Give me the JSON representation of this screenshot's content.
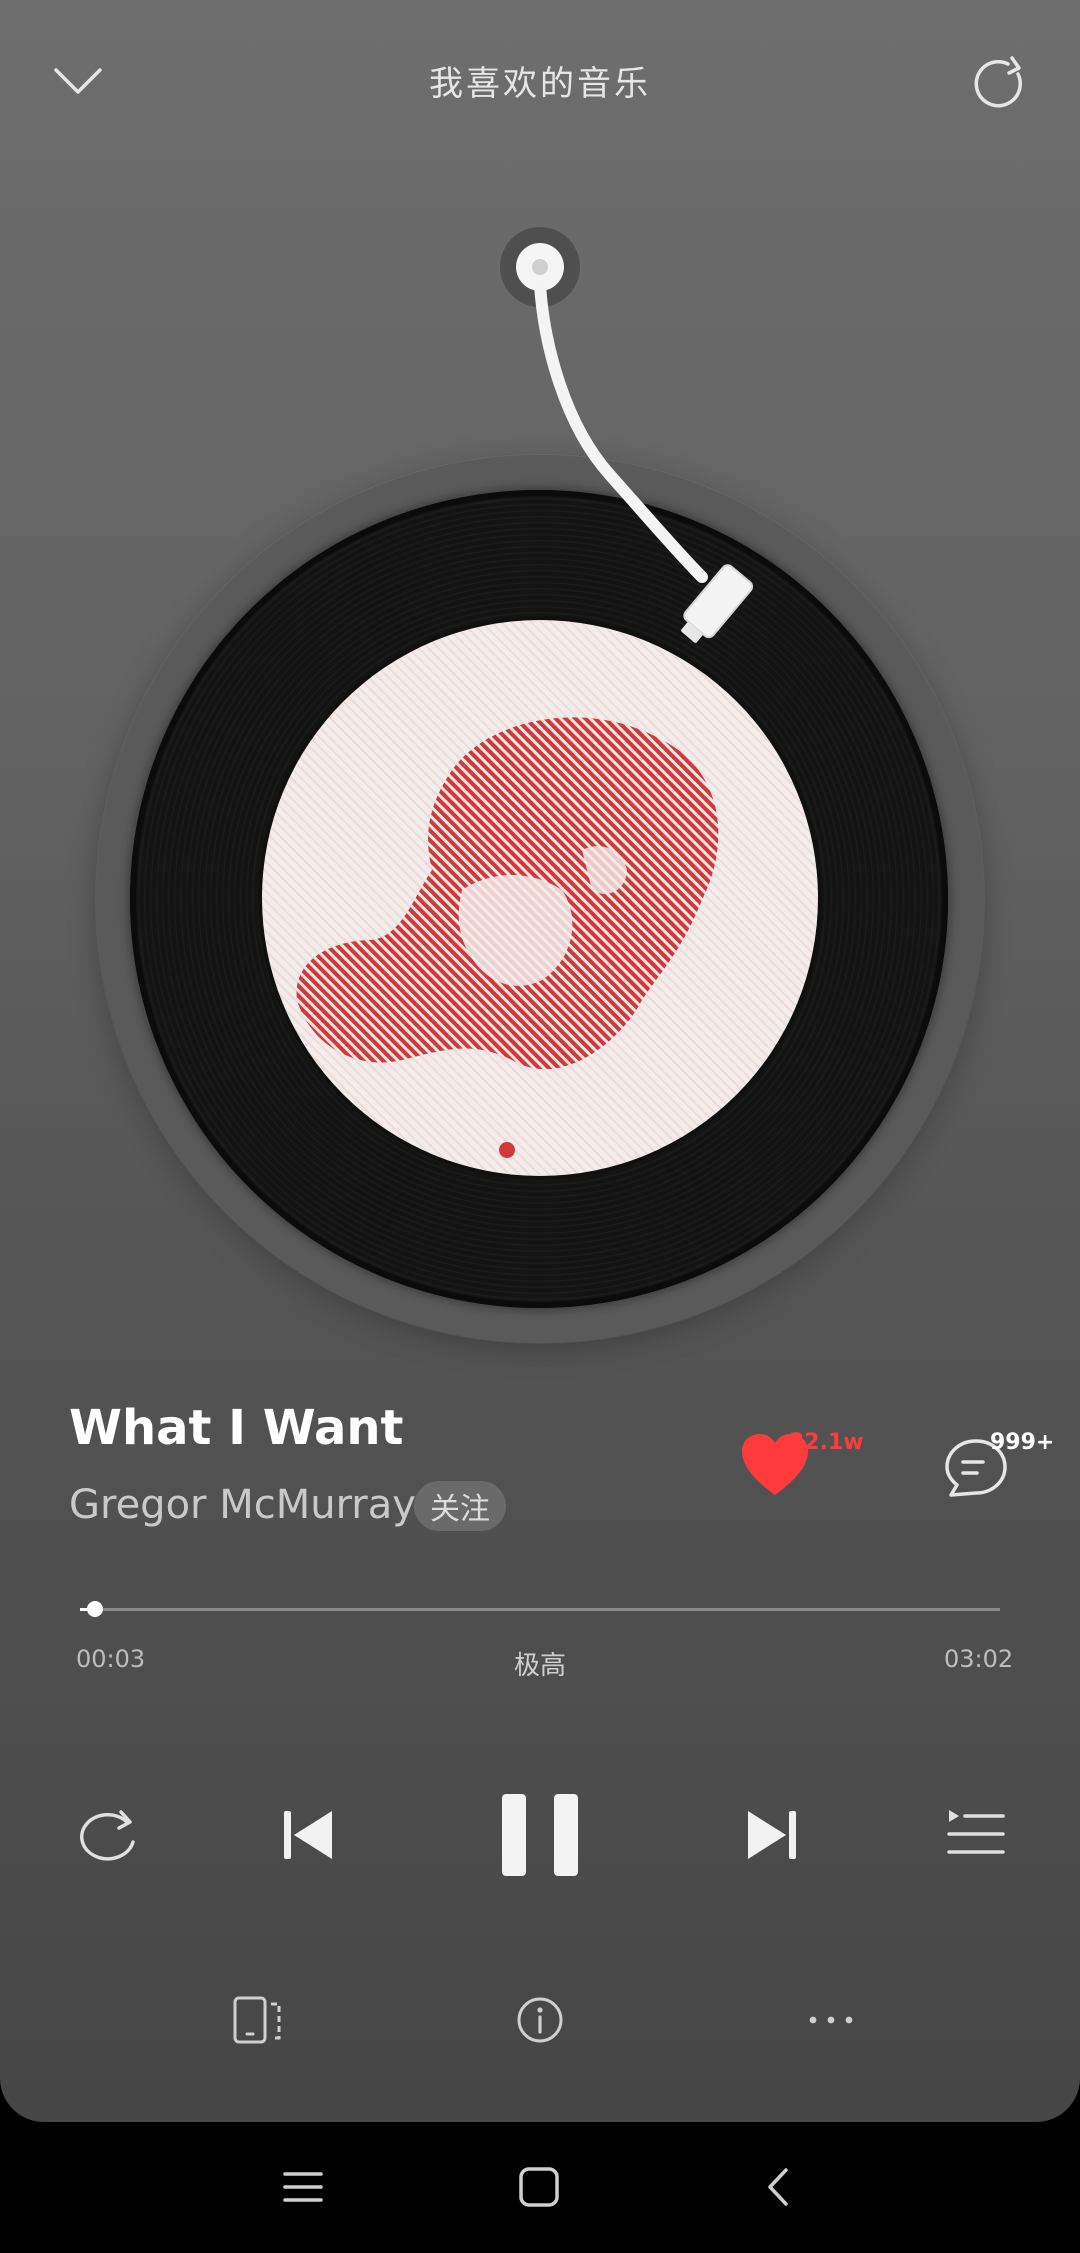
{
  "header": {
    "title": "我喜欢的音乐",
    "collapse_icon": "chevron-down-icon",
    "share_icon": "share-arrow-icon"
  },
  "player": {
    "song_title": "What I Want",
    "artist": "Gregor McMurray",
    "follow_label": "关注",
    "like_count": "22.1w",
    "comment_count": "999+",
    "current_time": "00:03",
    "total_time": "03:02",
    "quality": "极高",
    "progress": 0.016
  },
  "controls": {
    "repeat_icon": "repeat-icon",
    "prev_icon": "skip-previous-icon",
    "play_pause_icon": "pause-icon",
    "next_icon": "skip-next-icon",
    "playlist_icon": "playlist-icon"
  },
  "bottom_tools": {
    "device_icon": "device-switch-icon",
    "info_icon": "info-icon",
    "more_icon": "more-icon"
  },
  "system_nav": {
    "menu_icon": "menu-icon",
    "home_icon": "home-icon",
    "back_icon": "back-icon"
  },
  "colors": {
    "accent": "#ff3b3b",
    "background_top": "#6e6e6e",
    "background_bottom": "#464646"
  }
}
